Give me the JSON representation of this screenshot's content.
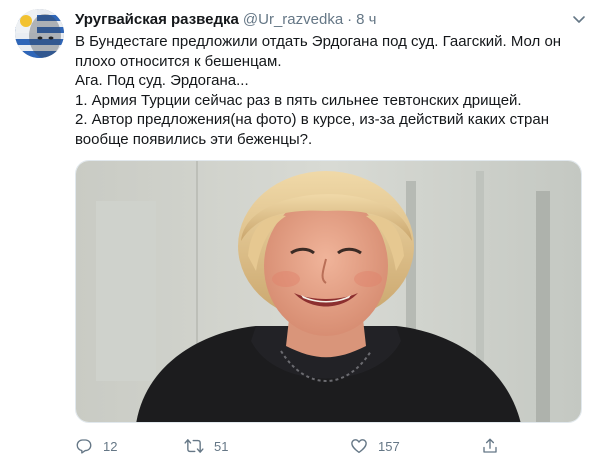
{
  "tweet": {
    "display_name": "Уругвайская разведка",
    "handle": "@Ur_razvedka",
    "separator": "·",
    "timestamp": "8 ч",
    "text_lines": [
      "В Бундестаге предложили отдать Эрдогана под суд. Гаагский. Мол он",
      "плохо относится к бешенцам.",
      "Ага. Под суд. Эрдогана...",
      "1. Армия Турции сейчас раз в пять сильнее тевтонских дрищей.",
      "2. Автор предложения(на фото) в курсе, из-за действий каких стран",
      "вообще появились эти беженцы?."
    ]
  },
  "actions": {
    "reply_count": "12",
    "retweet_count": "51",
    "like_count": "157"
  },
  "icons": {
    "caret": "chevron-down-icon",
    "reply": "reply-icon",
    "retweet": "retweet-icon",
    "like": "heart-icon",
    "share": "share-icon"
  },
  "colors": {
    "text_primary": "#14171a",
    "text_secondary": "#657786",
    "border": "#e1e8ed"
  }
}
